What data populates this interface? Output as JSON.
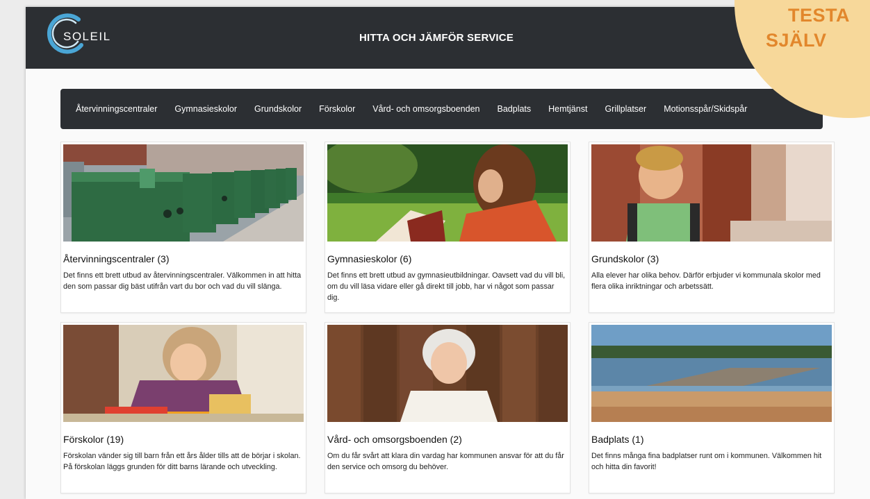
{
  "header": {
    "logo_text": "SOLEIL",
    "title": "HITTA OCH JÄMFÖR SERVICE"
  },
  "badge": {
    "line1": "TESTA",
    "line2": "SJÄLV"
  },
  "nav": {
    "items": [
      {
        "label": "Återvinningscentraler"
      },
      {
        "label": "Gymnasieskolor"
      },
      {
        "label": "Grundskolor"
      },
      {
        "label": "Förskolor"
      },
      {
        "label": "Vård- och omsorgsboenden"
      },
      {
        "label": "Badplats"
      },
      {
        "label": "Hemtjänst"
      },
      {
        "label": "Grillplatser"
      },
      {
        "label": "Motionsspår/Skidspår"
      }
    ]
  },
  "cards": [
    {
      "title": "Återvinningscentraler (3)",
      "text": "Det finns ett brett utbud av återvinningscentraler. Välkommen in att hitta den som passar dig bäst utifrån vart du bor och vad du vill slänga."
    },
    {
      "title": "Gymnasieskolor (6)",
      "text": "Det finns ett brett utbud av gymnasieutbildningar. Oavsett vad du vill bli, om du vill läsa vidare eller gå direkt till jobb, har vi något som passar dig."
    },
    {
      "title": "Grundskolor (3)",
      "text": "Alla elever har olika behov. Därför erbjuder vi kommunala skolor med flera olika inriktningar och arbetssätt."
    },
    {
      "title": "Förskolor (19)",
      "text": "Förskolan vänder sig till barn från ett års ålder tills att de börjar i skolan. På förskolan läggs grunden för ditt barns lärande och utveckling."
    },
    {
      "title": "Vård- och omsorgsboenden (2)",
      "text": "Om du får svårt att klara din vardag har kommunen ansvar för att du får den service och omsorg du behöver."
    },
    {
      "title": "Badplats (1)",
      "text": "Det finns många fina badplatser runt om i kommunen. Välkommen hit och hitta din favorit!"
    }
  ],
  "colors": {
    "header_bg": "#2c2f33",
    "badge_bg": "#f7d89a",
    "badge_text": "#e2872c",
    "logo_ring": "#4aa6d6"
  }
}
